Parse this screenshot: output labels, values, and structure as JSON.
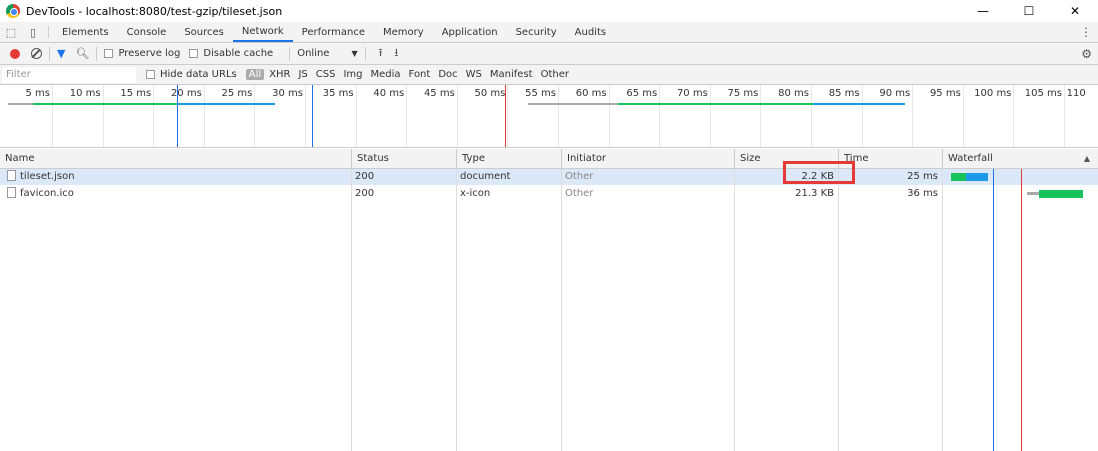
{
  "window": {
    "title": "DevTools - localhost:8080/test-gzip/tileset.json",
    "minimize": "—",
    "maximize": "☐",
    "close": "✕"
  },
  "tabs": [
    "Elements",
    "Console",
    "Sources",
    "Network",
    "Performance",
    "Memory",
    "Application",
    "Security",
    "Audits"
  ],
  "active_tab": "Network",
  "toolbar": {
    "preserve_log": "Preserve log",
    "disable_cache": "Disable cache",
    "throttle": "Online"
  },
  "filterbar": {
    "placeholder": "Filter",
    "hide_data_urls": "Hide data URLs",
    "types": [
      "All",
      "XHR",
      "JS",
      "CSS",
      "Img",
      "Media",
      "Font",
      "Doc",
      "WS",
      "Manifest",
      "Other"
    ],
    "active_type": "All"
  },
  "overview": {
    "labels": [
      "5 ms",
      "10 ms",
      "15 ms",
      "20 ms",
      "25 ms",
      "30 ms",
      "35 ms",
      "40 ms",
      "45 ms",
      "50 ms",
      "55 ms",
      "60 ms",
      "65 ms",
      "70 ms",
      "75 ms",
      "80 ms",
      "85 ms",
      "90 ms",
      "95 ms",
      "100 ms",
      "105 ms",
      "110"
    ]
  },
  "table": {
    "columns": [
      "Name",
      "Status",
      "Type",
      "Initiator",
      "Size",
      "Time",
      "Waterfall"
    ],
    "rows": [
      {
        "name": "tileset.json",
        "status": "200",
        "type": "document",
        "initiator": "Other",
        "size": "2.2 KB",
        "time": "25 ms"
      },
      {
        "name": "favicon.ico",
        "status": "200",
        "type": "x-icon",
        "initiator": "Other",
        "size": "21.3 KB",
        "time": "36 ms"
      }
    ]
  },
  "colors": {
    "accent": "#1a73e8",
    "record": "#e53935",
    "waterfall_green": "#19c35b",
    "waterfall_blue": "#1e9be8",
    "highlight": "#e53935"
  }
}
